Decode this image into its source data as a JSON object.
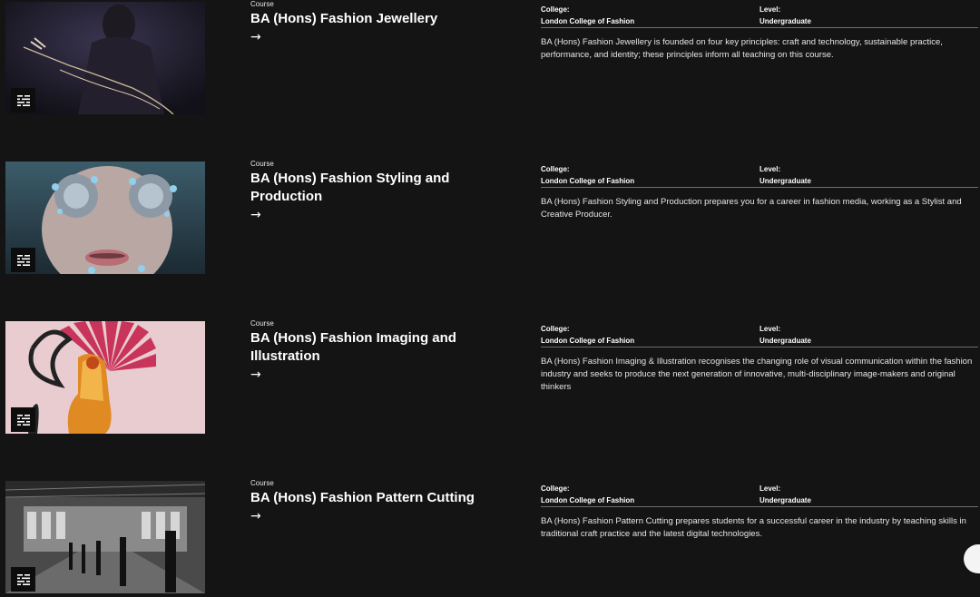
{
  "courses": [
    {
      "kicker": "Course",
      "title": "BA (Hons) Fashion Jewellery",
      "arrow": "→",
      "college_label": "College:",
      "college": "London College of Fashion",
      "level_label": "Level:",
      "level": "Undergraduate",
      "description": "BA (Hons) Fashion Jewellery is founded on four key principles: craft and technology, sustainable practice, performance, and identity; these principles inform all teaching on this course.",
      "image_icon": "image-filter-icon"
    },
    {
      "kicker": "Course",
      "title": "BA (Hons) Fashion Styling and Production",
      "arrow": "→",
      "college_label": "College:",
      "college": "London College of Fashion",
      "level_label": "Level:",
      "level": "Undergraduate",
      "description": "BA (Hons) Fashion Styling and Production prepares you for a career in fashion media, working as a Stylist and Creative Producer.",
      "image_icon": "image-filter-icon"
    },
    {
      "kicker": "Course",
      "title": "BA (Hons) Fashion Imaging and Illustration",
      "arrow": "→",
      "college_label": "College:",
      "college": "London College of Fashion",
      "level_label": "Level:",
      "level": "Undergraduate",
      "description": "BA (Hons) Fashion Imaging & Illustration recognises the changing role of visual communication within the fashion industry and seeks to produce the next generation of innovative, multi-disciplinary image-makers and original thinkers",
      "image_icon": "image-filter-icon"
    },
    {
      "kicker": "Course",
      "title": "BA (Hons) Fashion Pattern Cutting",
      "arrow": "→",
      "college_label": "College:",
      "college": "London College of Fashion",
      "level_label": "Level:",
      "level": "Undergraduate",
      "description": "BA (Hons) Fashion Pattern Cutting prepares students for a successful career in the industry by teaching skills in traditional craft practice and the latest digital technologies.",
      "image_icon": "image-filter-icon"
    }
  ],
  "colors": {
    "background": "#141414",
    "text": "#ffffff",
    "divider": "#6e6e6e"
  }
}
